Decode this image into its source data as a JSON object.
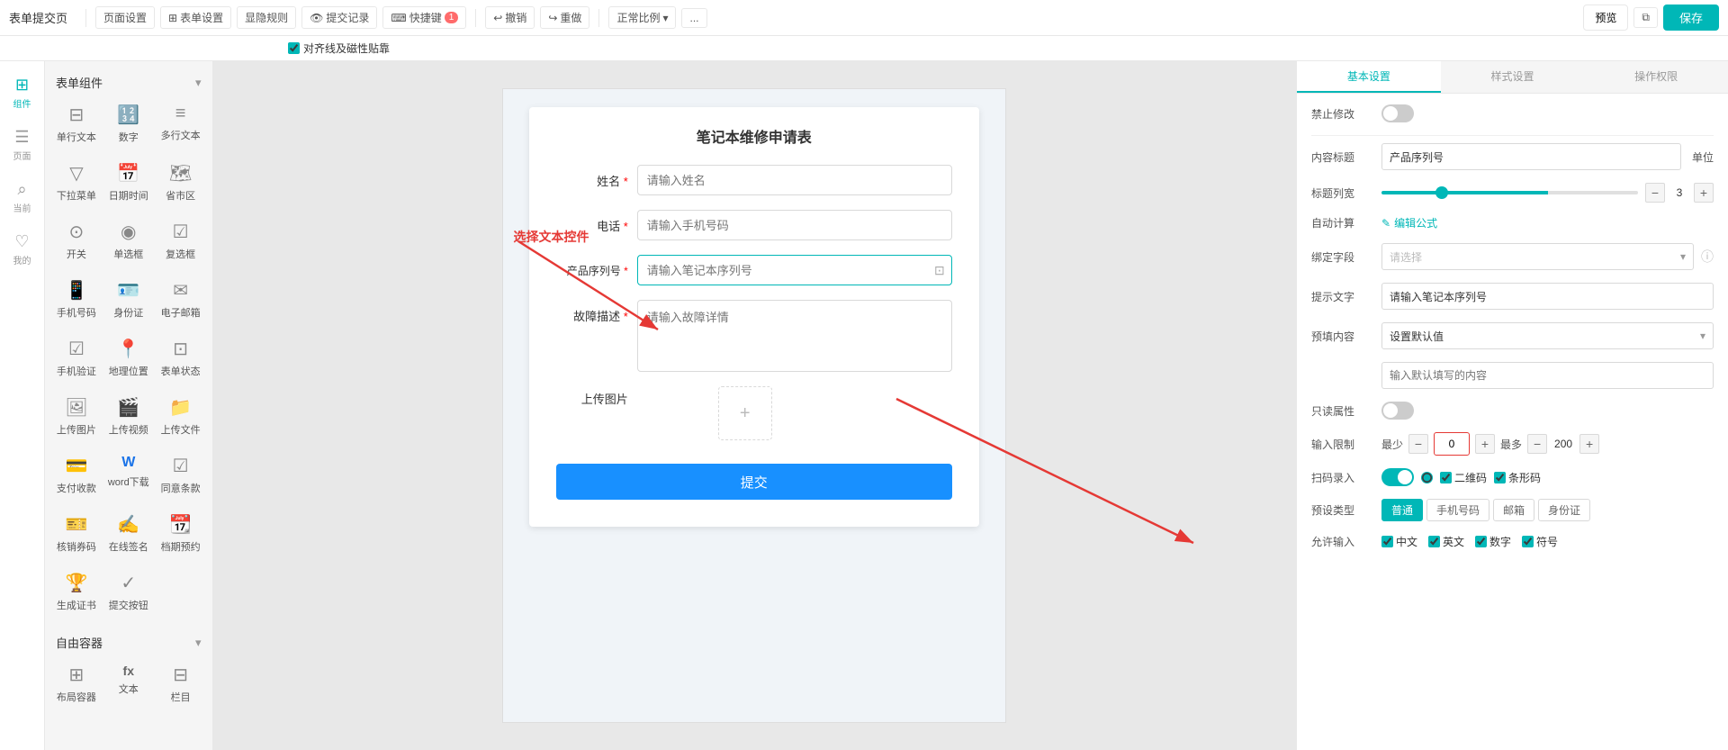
{
  "topbar": {
    "title": "表单提交页",
    "page_settings": "页面设置",
    "form_settings": "表单设置",
    "display_rules": "显隐规则",
    "submit_records": "提交记录",
    "shortcuts": "快捷键",
    "counter": "1",
    "undo": "撤销",
    "redo": "重做",
    "scale": "正常比例",
    "more": "...",
    "preview": "预览",
    "save": "保存",
    "align_checkbox": "对齐线及磁性贴靠"
  },
  "left_nav": {
    "items": [
      {
        "id": "components",
        "label": "组件",
        "icon": "⊞"
      },
      {
        "id": "pages",
        "label": "页面",
        "icon": "☰"
      },
      {
        "id": "search",
        "label": "当前",
        "icon": "⌕"
      },
      {
        "id": "mine",
        "label": "我的",
        "icon": "♡"
      }
    ]
  },
  "components_panel": {
    "form_components_title": "表单组件",
    "free_container_title": "自由容器",
    "items": [
      {
        "id": "single-text",
        "label": "单行文本",
        "icon": "⊟"
      },
      {
        "id": "number",
        "label": "数字",
        "icon": "⊞"
      },
      {
        "id": "multi-text",
        "label": "多行文本",
        "icon": "≡"
      },
      {
        "id": "dropdown",
        "label": "下拉菜单",
        "icon": "▽"
      },
      {
        "id": "datetime",
        "label": "日期时间",
        "icon": "📅"
      },
      {
        "id": "province",
        "label": "省市区",
        "icon": "📍"
      },
      {
        "id": "switch",
        "label": "开关",
        "icon": "⊙"
      },
      {
        "id": "radio",
        "label": "单选框",
        "icon": "◉"
      },
      {
        "id": "checkbox",
        "label": "复选框",
        "icon": "☑"
      },
      {
        "id": "phone",
        "label": "手机号码",
        "icon": "📱"
      },
      {
        "id": "id-card",
        "label": "身份证",
        "icon": "🪪"
      },
      {
        "id": "email",
        "label": "电子邮箱",
        "icon": "✉"
      },
      {
        "id": "sms-verify",
        "label": "手机验证",
        "icon": "☑"
      },
      {
        "id": "location",
        "label": "地理位置",
        "icon": "📍"
      },
      {
        "id": "form-status",
        "label": "表单状态",
        "icon": "⊡"
      },
      {
        "id": "upload-image",
        "label": "上传图片",
        "icon": "🖼"
      },
      {
        "id": "upload-video",
        "label": "上传视频",
        "icon": "🎬"
      },
      {
        "id": "upload-file",
        "label": "上传文件",
        "icon": "📁"
      },
      {
        "id": "payment",
        "label": "支付收款",
        "icon": "💳"
      },
      {
        "id": "word-download",
        "label": "word下载",
        "icon": "W"
      },
      {
        "id": "agreement",
        "label": "同意条款",
        "icon": "☑"
      },
      {
        "id": "coupon",
        "label": "核销券码",
        "icon": "🎫"
      },
      {
        "id": "signature",
        "label": "在线签名",
        "icon": "✍"
      },
      {
        "id": "reservation",
        "label": "档期预约",
        "icon": "📆"
      },
      {
        "id": "certificate",
        "label": "生成证书",
        "icon": "🏆"
      },
      {
        "id": "submit-btn",
        "label": "提交按钮",
        "icon": "✓"
      }
    ],
    "free_items": [
      {
        "id": "layout",
        "label": "布局容器",
        "icon": "⊞"
      },
      {
        "id": "formula",
        "label": "文本",
        "icon": "fx"
      },
      {
        "id": "image2",
        "label": "栏目",
        "icon": "⊟"
      }
    ]
  },
  "form": {
    "title": "笔记本维修申请表",
    "fields": [
      {
        "label": "姓名",
        "required": true,
        "placeholder": "请输入姓名",
        "type": "text"
      },
      {
        "label": "电话",
        "required": true,
        "placeholder": "请输入手机号码",
        "type": "tel"
      },
      {
        "label": "产品序列号",
        "required": true,
        "placeholder": "请输入笔记本序列号",
        "type": "text",
        "highlighted": true
      },
      {
        "label": "故障描述",
        "required": true,
        "placeholder": "请输入故障详情",
        "type": "textarea"
      }
    ],
    "upload_label": "上传图片",
    "upload_placeholder": "+",
    "submit_btn": "提交"
  },
  "annotation": {
    "select_text": "选择文本控件"
  },
  "right_panel": {
    "tabs": [
      {
        "id": "basic",
        "label": "基本设置",
        "active": true
      },
      {
        "id": "style",
        "label": "样式设置"
      },
      {
        "id": "permission",
        "label": "操作权限"
      }
    ],
    "disable_edit_label": "禁止修改",
    "disable_edit_on": false,
    "content_title_label": "内容标题",
    "content_title_value": "产品序列号",
    "content_title_unit": "单位",
    "label_width_label": "标题列宽",
    "label_width_value": 3,
    "auto_calc_label": "自动计算",
    "auto_calc_btn": "编辑公式",
    "bind_field_label": "绑定字段",
    "bind_field_placeholder": "请选择",
    "hint_text_label": "提示文字",
    "hint_text_value": "请输入笔记本序列号",
    "prefill_label": "预填内容",
    "prefill_value": "设置默认值",
    "prefill_input_placeholder": "输入默认填写的内容",
    "readonly_label": "只读属性",
    "readonly_on": false,
    "input_limit_label": "输入限制",
    "input_min_label": "最少",
    "input_min_value": "0",
    "input_max_label": "最多",
    "input_max_value": "200",
    "scan_label": "扫码录入",
    "scan_on": true,
    "scan_qr": "二维码",
    "scan_barcode": "条形码",
    "preset_type_label": "预设类型",
    "preset_types": [
      {
        "label": "普通",
        "active": true
      },
      {
        "label": "手机号码",
        "active": false
      },
      {
        "label": "邮箱",
        "active": false
      },
      {
        "label": "身份证",
        "active": false
      }
    ],
    "allow_input_label": "允许输入",
    "allow_chinese": "中文",
    "allow_english": "英文",
    "allow_number": "数字",
    "allow_symbol": "符号"
  }
}
